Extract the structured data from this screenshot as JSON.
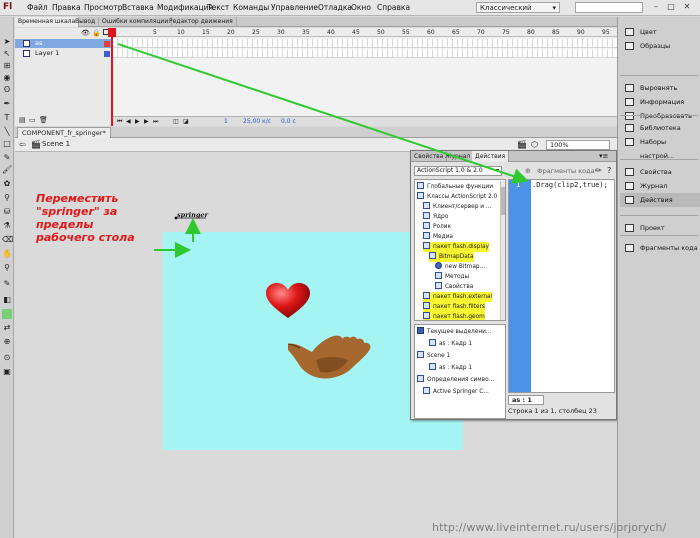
{
  "app": {
    "logo": "Fl",
    "menus": [
      "Файл",
      "Правка",
      "Просмотр",
      "Вставка",
      "Модификация",
      "Текст",
      "Команды",
      "Управление",
      "Отладка",
      "Окно",
      "Справка"
    ],
    "workspace": "Классический",
    "window_buttons": [
      "–",
      "□",
      "✕"
    ]
  },
  "timeline_tabs": [
    "Временная шкала",
    "Вывод",
    "Ошибки компиляции",
    "Редактор движения"
  ],
  "timeline": {
    "layers": [
      "as",
      "Layer 1"
    ],
    "frame_numbers": [
      "5",
      "10",
      "15",
      "20",
      "25",
      "30",
      "35",
      "40",
      "45",
      "50",
      "55",
      "60",
      "65",
      "70",
      "75",
      "80",
      "85",
      "90",
      "95"
    ],
    "current_frame": "1",
    "fps": "25,00 к/с",
    "time": "0,0 с"
  },
  "document": {
    "tab_label": "COMPONENT_fr_springer*",
    "scene": "Scene 1",
    "zoom": "100%"
  },
  "stage": {
    "annotation_lines": [
      "Переместить",
      "\"springer\" за",
      "пределы",
      "рабочего стола"
    ],
    "springer_label": "springer",
    "color": "#a4f4f4",
    "arrow_color": "#2ec92e"
  },
  "actions_panel": {
    "tabs": [
      "Свойства",
      "Журнал",
      "Действия"
    ],
    "version": "ActionScript 1.0 & 2.0",
    "fragments_label": "Фрагменты кода",
    "tree_top": [
      {
        "label": "Глобальные функции",
        "indent": 0,
        "hl": false,
        "icon": "book"
      },
      {
        "label": "Классы ActionScript 2.0",
        "indent": 0,
        "hl": false,
        "icon": "book"
      },
      {
        "label": "Клиент/сервер и ...",
        "indent": 1,
        "hl": false,
        "icon": "book"
      },
      {
        "label": "Ядро",
        "indent": 1,
        "hl": false,
        "icon": "book"
      },
      {
        "label": "Ролик",
        "indent": 1,
        "hl": false,
        "icon": "book"
      },
      {
        "label": "Медиа",
        "indent": 1,
        "hl": false,
        "icon": "book"
      },
      {
        "label": "пакет flash.display",
        "indent": 1,
        "hl": true,
        "icon": "book"
      },
      {
        "label": "BitmapData",
        "indent": 2,
        "hl": true,
        "icon": "book"
      },
      {
        "label": "new Bitmap...",
        "indent": 3,
        "hl": false,
        "icon": "dot"
      },
      {
        "label": "Методы",
        "indent": 3,
        "hl": false,
        "icon": "book"
      },
      {
        "label": "Свойства",
        "indent": 3,
        "hl": false,
        "icon": "book"
      },
      {
        "label": "пакет flash.external",
        "indent": 1,
        "hl": true,
        "icon": "book"
      },
      {
        "label": "пакет flash.filters",
        "indent": 1,
        "hl": true,
        "icon": "book"
      },
      {
        "label": "пакет flash.geom",
        "indent": 1,
        "hl": true,
        "icon": "book"
      }
    ],
    "tree_bottom": [
      {
        "label": "Текущее выделени...",
        "indent": 0,
        "icon": "book"
      },
      {
        "label": "as : Кадр 1",
        "indent": 2,
        "icon": "frame"
      },
      {
        "label": "Scene 1",
        "indent": 0,
        "icon": "frame"
      },
      {
        "label": "as : Кадр 1",
        "indent": 2,
        "icon": "frame"
      },
      {
        "label": "Определения симво...",
        "indent": 0,
        "icon": "frame"
      },
      {
        "label": "Active Springer C...",
        "indent": 1,
        "icon": "frame"
      }
    ],
    "line_number": "1",
    "code": ".Drag(clip2,true);",
    "code_tab": "as : 1",
    "status": "Строка 1 из 1, столбец 23"
  },
  "right_panel": {
    "items": [
      {
        "label": "Цвет",
        "group": 0
      },
      {
        "label": "Образцы",
        "group": 0
      },
      {
        "label": "Выровнять",
        "group": 1
      },
      {
        "label": "Информация",
        "group": 1
      },
      {
        "label": "Преобразовать",
        "group": 1
      },
      {
        "label": "Библиотека",
        "group": 2
      },
      {
        "label": "Наборы настрой...",
        "group": 2
      },
      {
        "label": "Свойства",
        "group": 3
      },
      {
        "label": "Журнал",
        "group": 3
      },
      {
        "label": "Действия",
        "group": 3
      },
      {
        "label": "Проект",
        "group": 4
      },
      {
        "label": "Фрагменты кода",
        "group": 5
      }
    ],
    "active": "Действия"
  },
  "watermark": "http://www.liveinternet.ru/users/jorjorych/"
}
